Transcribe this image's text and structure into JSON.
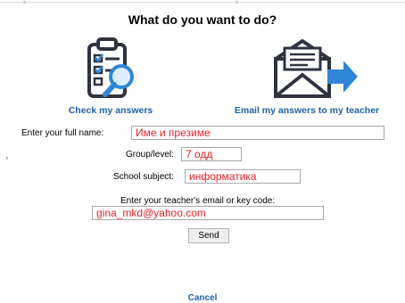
{
  "dialog": {
    "title": "What do you want to do?",
    "actions": {
      "check": {
        "label": "Check my answers",
        "icon": "clipboard-magnifier-icon"
      },
      "email": {
        "label": "Email my answers to my teacher",
        "icon": "envelope-arrow-icon"
      }
    },
    "form": {
      "full_name": {
        "label": "Enter your full name:",
        "value": "Име и презиме"
      },
      "group": {
        "label": "Group/level:",
        "value": "7 одд"
      },
      "subject": {
        "label": "School subject:",
        "value": "информатика"
      },
      "teacher": {
        "label": "Enter your teacher's email or key code:",
        "value": "gina_mkd@yahoo.com"
      }
    },
    "send_label": "Send",
    "cancel_label": "Cancel"
  },
  "colors": {
    "link": "#2060a8",
    "entered_text": "#e8202a",
    "arrow": "#2f86d6",
    "icon_dark": "#2f3340"
  }
}
